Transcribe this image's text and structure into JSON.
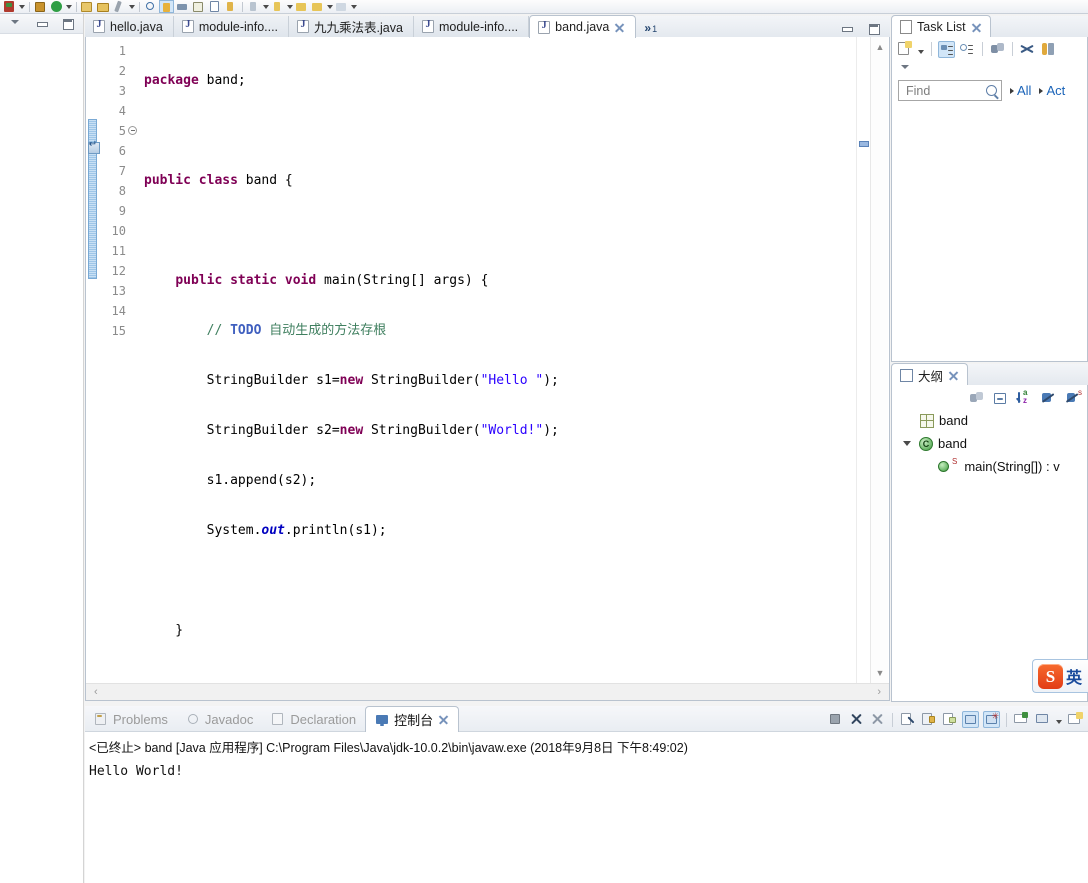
{
  "window": {
    "app": "Eclipse IDE"
  },
  "toolbar": {
    "groups": [
      {
        "name": "debug-group",
        "items": [
          "debug-icon",
          "dropdown-arrow"
        ]
      },
      {
        "name": "run-group",
        "items": [
          "run-icon",
          "dropdown-arrow"
        ]
      },
      {
        "name": "coverage-group",
        "items": [
          "coverage-icon",
          "new-icon"
        ]
      },
      {
        "name": "file-group",
        "items": [
          "open-folder-icon",
          "save-icon",
          "brush-icon",
          "dropdown-arrow"
        ]
      },
      {
        "name": "search-group",
        "items": [
          "search-icon",
          "highlight-icon",
          "link-icon",
          "package-icon",
          "outline-icon",
          "marker-icon",
          "dropdown-arrow"
        ]
      },
      {
        "name": "nav-group",
        "items": [
          "next-annotation-icon",
          "dropdown-arrow",
          "prev-annotation-icon",
          "dropdown-arrow",
          "back-icon",
          "forward-icon",
          "dropdown-arrow"
        ]
      }
    ]
  },
  "left_stub": {
    "controls": [
      "minimize-icon",
      "restore-icon",
      "maximize-icon"
    ]
  },
  "editor": {
    "tabs": [
      {
        "label": "hello.java",
        "active": false,
        "closable": false
      },
      {
        "label": "module-info....",
        "active": false,
        "closable": false
      },
      {
        "label": "九九乘法表.java",
        "active": false,
        "closable": false
      },
      {
        "label": "module-info....",
        "active": false,
        "closable": false
      },
      {
        "label": "band.java",
        "active": true,
        "closable": true
      }
    ],
    "overflow_chevron": "»",
    "overflow_count": "1",
    "stack_controls": [
      "restore-icon",
      "maximize-icon"
    ],
    "current_line": 15,
    "lines": [
      {
        "n": "1",
        "fold": false,
        "tokens": [
          {
            "t": "package",
            "c": "k"
          },
          {
            "t": " band;",
            "c": "pl"
          }
        ]
      },
      {
        "n": "2",
        "fold": false,
        "tokens": []
      },
      {
        "n": "3",
        "fold": false,
        "tokens": [
          {
            "t": "public class",
            "c": "k"
          },
          {
            "t": " band {",
            "c": "pl"
          }
        ]
      },
      {
        "n": "4",
        "fold": false,
        "tokens": []
      },
      {
        "n": "5",
        "fold": true,
        "tokens": [
          {
            "t": "    ",
            "c": "pl"
          },
          {
            "t": "public static void",
            "c": "k"
          },
          {
            "t": " main(String[] args) {",
            "c": "pl"
          }
        ]
      },
      {
        "n": "6",
        "fold": false,
        "tokens": [
          {
            "t": "        // ",
            "c": "cm"
          },
          {
            "t": "TODO",
            "c": "td"
          },
          {
            "t": " 自动生成的方法存根",
            "c": "cm"
          }
        ]
      },
      {
        "n": "7",
        "fold": false,
        "tokens": [
          {
            "t": "        StringBuilder s1=",
            "c": "pl"
          },
          {
            "t": "new",
            "c": "k"
          },
          {
            "t": " StringBuilder(",
            "c": "pl"
          },
          {
            "t": "\"Hello \"",
            "c": "st"
          },
          {
            "t": ");",
            "c": "pl"
          }
        ]
      },
      {
        "n": "8",
        "fold": false,
        "tokens": [
          {
            "t": "        StringBuilder s2=",
            "c": "pl"
          },
          {
            "t": "new",
            "c": "k"
          },
          {
            "t": " StringBuilder(",
            "c": "pl"
          },
          {
            "t": "\"World!\"",
            "c": "st"
          },
          {
            "t": ");",
            "c": "pl"
          }
        ]
      },
      {
        "n": "9",
        "fold": false,
        "tokens": [
          {
            "t": "        s1.append(s2);",
            "c": "pl"
          }
        ]
      },
      {
        "n": "10",
        "fold": false,
        "tokens": [
          {
            "t": "        System.",
            "c": "pl"
          },
          {
            "t": "out",
            "c": "fld"
          },
          {
            "t": ".println(s1);",
            "c": "pl"
          }
        ]
      },
      {
        "n": "11",
        "fold": false,
        "tokens": []
      },
      {
        "n": "12",
        "fold": false,
        "tokens": [
          {
            "t": "    }",
            "c": "pl"
          }
        ]
      },
      {
        "n": "13",
        "fold": false,
        "tokens": []
      },
      {
        "n": "14",
        "fold": false,
        "tokens": [
          {
            "t": "}",
            "c": "pl"
          }
        ]
      },
      {
        "n": "15",
        "fold": false,
        "tokens": []
      }
    ],
    "hscroll_left": "‹",
    "hscroll_right": "›"
  },
  "task_list": {
    "title": "Task List",
    "close_icon": "close-icon",
    "toolbar": [
      "new-task-icon",
      "dropdown-arrow-icon",
      "categorized-presentation-icon",
      "scheduled-presentation-icon",
      "focus-on-workweek-icon",
      "synchronize-changed-icon",
      "find-similar-icon"
    ],
    "toolbar2": [
      "view-menu-icon"
    ],
    "find": {
      "placeholder": "Find",
      "value": "",
      "search_icon": "search-icon"
    },
    "links": [
      "All",
      "Act"
    ]
  },
  "outline": {
    "title": "大纲",
    "close_icon": "close-icon",
    "toolbar": [
      "focus-on-active-task-icon",
      "collapse-all-icon",
      "sort-icon",
      "hide-fields-icon",
      "hide-static-icon"
    ],
    "tree": [
      {
        "label": "band",
        "icon": "package-icon",
        "twisty": false,
        "indent": 0
      },
      {
        "label": "band",
        "icon": "class-icon",
        "twisty": true,
        "indent": 0
      },
      {
        "label": "main(String[]) : v",
        "icon": "method-icon",
        "badge": "S",
        "twisty": false,
        "indent": 1
      }
    ]
  },
  "console": {
    "tabs": [
      {
        "label": "Problems",
        "icon": "problems-icon",
        "active": false
      },
      {
        "label": "Javadoc",
        "icon": "javadoc-icon",
        "active": false
      },
      {
        "label": "Declaration",
        "icon": "declaration-icon",
        "active": false
      },
      {
        "label": "控制台",
        "icon": "console-icon",
        "active": true,
        "closable": true
      }
    ],
    "toolbar": [
      "terminate-icon",
      "remove-launch-icon",
      "remove-all-launches-icon",
      "clear-console-icon",
      "scroll-lock-icon",
      "word-wrap-icon",
      "show-console-on-output-icon",
      "pin-console-icon",
      "display-selected-console-icon",
      "open-console-icon",
      "console-menu-arrow-icon",
      "new-console-view-icon"
    ],
    "status_line": "<已终止> band [Java 应用程序] C:\\Program Files\\Java\\jdk-10.0.2\\bin\\javaw.exe  (2018年9月8日 下午8:49:02)",
    "output": "Hello World!"
  },
  "ime": {
    "logo": "sogou-logo",
    "mode": "英"
  },
  "colors": {
    "keyword": "#7f0055",
    "string": "#2a00ff",
    "comment": "#3f7f5f",
    "todo": "#3f5fbf",
    "field": "#0000c0",
    "link": "#1a63b8",
    "selection": "#d2e6f8",
    "current_line": "#e8f2fd",
    "sogou_orange": "#e23c16"
  }
}
